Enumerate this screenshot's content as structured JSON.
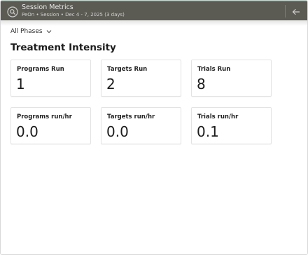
{
  "header": {
    "title": "Session Metrics",
    "subtitle": "PeOn • Session • Dec 4 - 7, 2025 (3 days)",
    "accent_color": "#2f8a62",
    "bar_color": "#5b5a53",
    "search_icon": "search-icon",
    "back_icon": "arrow-left-icon"
  },
  "filter": {
    "phase_label": "All Phases"
  },
  "section": {
    "title": "Treatment Intensity"
  },
  "metrics": [
    {
      "label": "Programs Run",
      "value": "1"
    },
    {
      "label": "Targets Run",
      "value": "2"
    },
    {
      "label": "Trials Run",
      "value": "8"
    },
    {
      "label": "Programs run/hr",
      "value": "0.0"
    },
    {
      "label": "Targets run/hr",
      "value": "0.0"
    },
    {
      "label": "Trials run/hr",
      "value": "0.1"
    }
  ]
}
